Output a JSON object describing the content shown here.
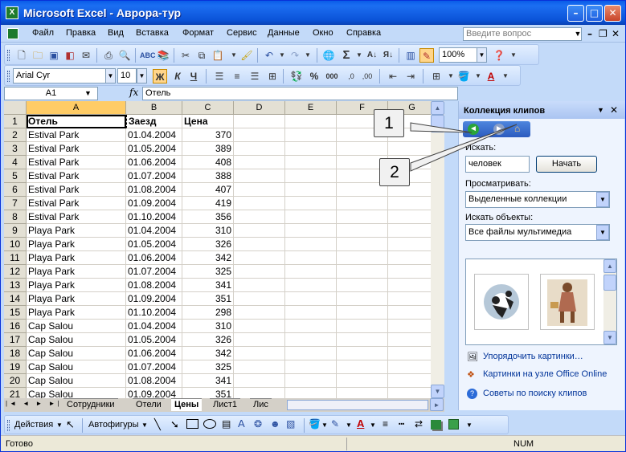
{
  "window": {
    "app_title": "Microsoft Excel - Аврора-тур",
    "app_icon": "excel-icon"
  },
  "menu": {
    "items": [
      "Файл",
      "Правка",
      "Вид",
      "Вставка",
      "Формат",
      "Сервис",
      "Данные",
      "Окно",
      "Справка"
    ],
    "ask_placeholder": "Введите вопрос"
  },
  "toolbar": {
    "zoom": "100%"
  },
  "format_toolbar": {
    "font": "Arial Cyr",
    "size": "10",
    "bold": "Ж",
    "italic": "К",
    "underline": "Ч",
    "percent": "%",
    "thousands": "000"
  },
  "formula_bar": {
    "name_box": "A1",
    "fx": "fx",
    "value": "Отель"
  },
  "sheet": {
    "columns": [
      "A",
      "B",
      "C",
      "D",
      "E",
      "F",
      "G"
    ],
    "rows": [
      [
        "Отель",
        "Заезд",
        "Цена"
      ],
      [
        "Estival Park",
        "01.04.2004",
        "370"
      ],
      [
        "Estival Park",
        "01.05.2004",
        "389"
      ],
      [
        "Estival Park",
        "01.06.2004",
        "408"
      ],
      [
        "Estival Park",
        "01.07.2004",
        "388"
      ],
      [
        "Estival Park",
        "01.08.2004",
        "407"
      ],
      [
        "Estival Park",
        "01.09.2004",
        "419"
      ],
      [
        "Estival Park",
        "01.10.2004",
        "356"
      ],
      [
        "Playa Park",
        "01.04.2004",
        "310"
      ],
      [
        "Playa Park",
        "01.05.2004",
        "326"
      ],
      [
        "Playa Park",
        "01.06.2004",
        "342"
      ],
      [
        "Playa Park",
        "01.07.2004",
        "325"
      ],
      [
        "Playa Park",
        "01.08.2004",
        "341"
      ],
      [
        "Playa Park",
        "01.09.2004",
        "351"
      ],
      [
        "Playa Park",
        "01.10.2004",
        "298"
      ],
      [
        "Cap Salou",
        "01.04.2004",
        "310"
      ],
      [
        "Cap Salou",
        "01.05.2004",
        "326"
      ],
      [
        "Cap Salou",
        "01.06.2004",
        "342"
      ],
      [
        "Cap Salou",
        "01.07.2004",
        "325"
      ],
      [
        "Cap Salou",
        "01.08.2004",
        "341"
      ],
      [
        "Cap Salou",
        "01.09.2004",
        "351"
      ]
    ],
    "row_numbers": [
      "1",
      "2",
      "3",
      "4",
      "5",
      "6",
      "7",
      "8",
      "9",
      "10",
      "11",
      "12",
      "13",
      "14",
      "15",
      "16",
      "17",
      "18",
      "19",
      "20",
      "21"
    ],
    "tabs": [
      "Сотрудники",
      "Отели",
      "Цены",
      "Лист1",
      "Лис"
    ],
    "active_tab": "Цены"
  },
  "task_pane": {
    "title": "Коллекция клипов",
    "search_label": "Искать:",
    "search_value": "человек",
    "search_button": "Начать",
    "browse_label": "Просматривать:",
    "browse_value": "Выделенные коллекции",
    "objects_label": "Искать объекты:",
    "objects_value": "Все файлы мультимедиа",
    "links": [
      "Упорядочить картинки…",
      "Картинки на узле Office Online",
      "Советы по поиску клипов"
    ]
  },
  "callouts": [
    "1",
    "2"
  ],
  "draw_toolbar": {
    "actions": "Действия",
    "autoshapes": "Автофигуры"
  },
  "status": {
    "text": "Готово",
    "num": "NUM"
  }
}
